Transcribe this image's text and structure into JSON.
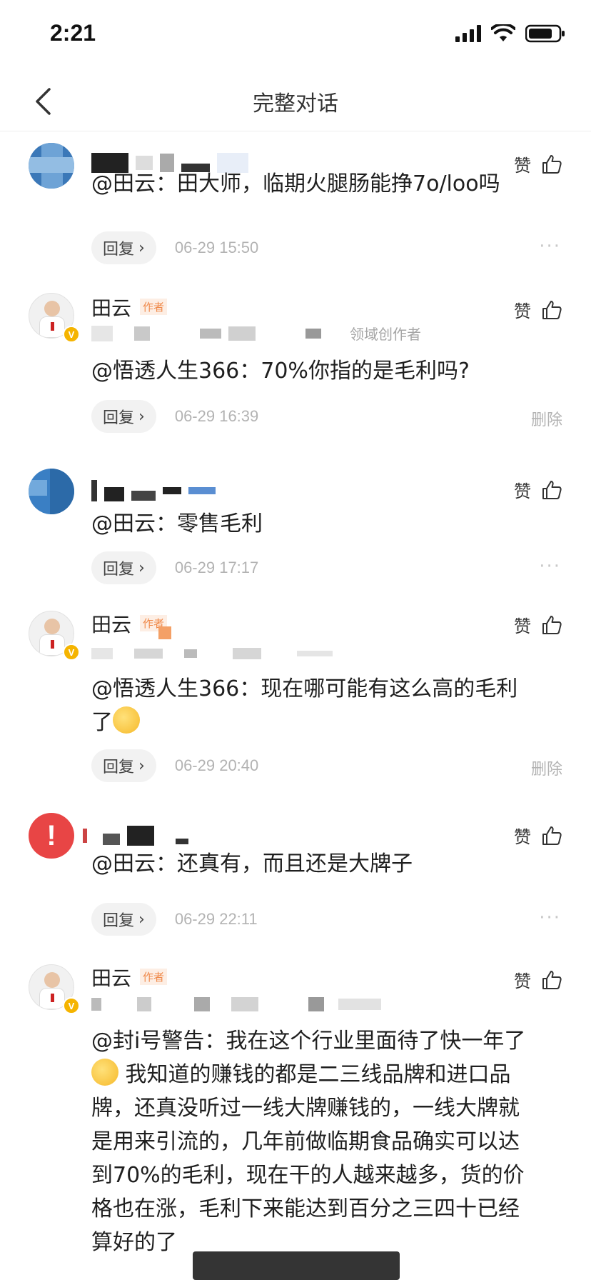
{
  "status": {
    "time": "2:21"
  },
  "nav": {
    "title": "完整对话"
  },
  "comments": [
    {
      "like_label": "赞",
      "text": "@田云：田大师，临期火腿肠能挣7o/loo吗",
      "reply_label": "回复",
      "time": "06-29 15:50",
      "action": "more"
    },
    {
      "author": "田云",
      "author_tag": "作者",
      "domain_label": "领域创作者",
      "like_label": "赞",
      "text": "@悟透人生366：70%你指的是毛利吗?",
      "reply_label": "回复",
      "time": "06-29 16:39",
      "action": "删除"
    },
    {
      "like_label": "赞",
      "text": "@田云：零售毛利",
      "reply_label": "回复",
      "time": "06-29 17:17",
      "action": "more"
    },
    {
      "author": "田云",
      "author_tag": "作者",
      "like_label": "赞",
      "text_line1": "@悟透人生366：现在哪可能有这么高的毛利",
      "text_line2": "了",
      "reply_label": "回复",
      "time": "06-29 20:40",
      "action": "删除"
    },
    {
      "like_label": "赞",
      "text": "@田云：还真有，而且还是大牌子",
      "reply_label": "回复",
      "time": "06-29 22:11",
      "action": "more"
    },
    {
      "author": "田云",
      "author_tag": "作者",
      "like_label": "赞",
      "text_line1": "@封i号警告：我在这个行业里面待了快一年了",
      "text_line2": "我知道的赚钱的都是二三线品牌和进口品",
      "text_line3": "牌，还真没听过一线大牌赚钱的，一线大牌就",
      "text_line4": "是用来引流的，几年前做临期食品确实可以达",
      "text_line5": "到70%的毛利，现在干的人越来越多，货的价",
      "text_line6": "格也在涨，毛利下来能达到百分之三四十已经",
      "text_line7": "算好的了"
    }
  ],
  "colors": {
    "verify": "#f5b400",
    "warning": "#e84545",
    "author_tag": "#f08a4b"
  }
}
